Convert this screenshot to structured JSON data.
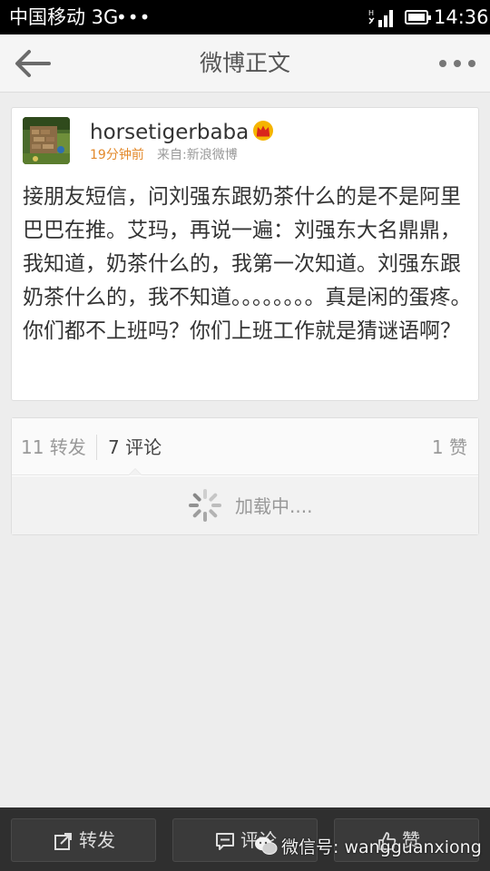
{
  "status_bar": {
    "carrier": "中国移动 3G",
    "dots": "•••",
    "time": "14:36"
  },
  "nav": {
    "title": "微博正文",
    "back_icon": "back-arrow-icon",
    "more_icon": "more-dots-icon"
  },
  "post": {
    "username": "horsetigerbaba",
    "badge_icon": "crown-icon",
    "time": "19分钟前",
    "source": "来自:新浪微博",
    "body": "接朋友短信，问刘强东跟奶茶什么的是不是阿里巴巴在推。艾玛，再说一遍：刘强东大名鼎鼎，我知道，奶茶什么的，我第一次知道。刘强东跟奶茶什么的，我不知道。。。。。。。。真是闲的蛋疼。你们都不上班吗？你们上班工作就是猜谜语啊？"
  },
  "stats": {
    "reposts": "11 转发",
    "comments": "7 评论",
    "likes": "1 赞",
    "loading": "加载中...."
  },
  "toolbar": {
    "repost_label": "转发",
    "comment_label": "评论",
    "like_label": "赞"
  },
  "watermark": {
    "text": "微信号: wangguanxiong"
  },
  "colors": {
    "time_accent": "#e3892b",
    "toolbar_bg": "#2f2f2f",
    "status_bar_bg": "#000000"
  }
}
